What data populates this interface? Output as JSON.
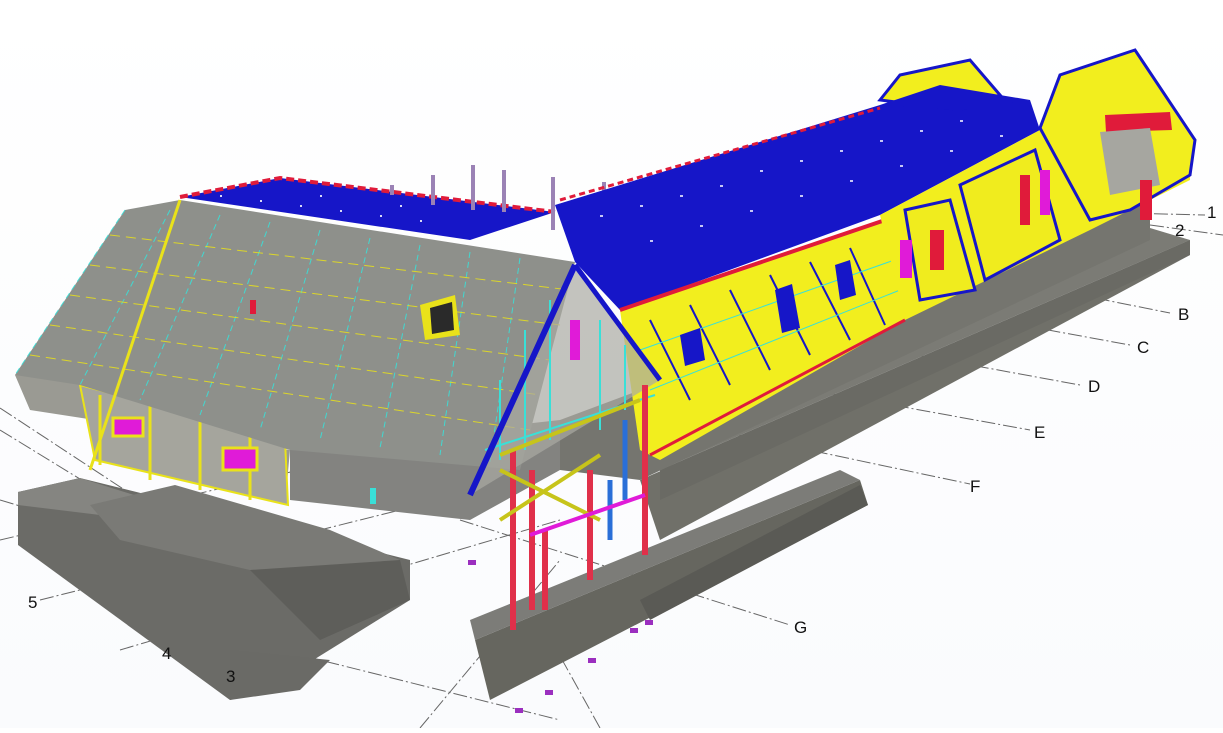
{
  "viewer": {
    "grid_labels": {
      "row_1": "1",
      "row_2": "2",
      "col_B": "B",
      "col_C": "C",
      "col_D": "D",
      "col_E": "E",
      "col_F": "F",
      "col_G": "G",
      "axis_5": "5",
      "axis_4": "4",
      "axis_3": "3"
    }
  },
  "colors": {
    "concrete": "#6f6f6b",
    "roof_panel": "#8e908b",
    "structure_yellow": "#f2ee1e",
    "roof_blue": "#1616c8",
    "opening_magenta": "#e01bd8",
    "steel_red": "#e0304a",
    "cyan_member": "#39e0d8",
    "grid_line": "#555555"
  }
}
